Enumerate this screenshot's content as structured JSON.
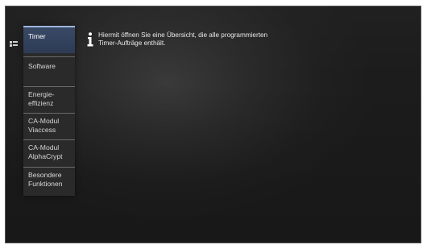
{
  "menu": {
    "toggle_icon": "menu-grid-icon",
    "items": [
      {
        "line1": "Timer",
        "line2": "",
        "active": true
      },
      {
        "line1": "Software",
        "line2": "",
        "active": false
      },
      {
        "line1": "Energie-",
        "line2": "effizienz",
        "active": false
      },
      {
        "line1": "CA-Modul",
        "line2": "Viaccess",
        "active": false
      },
      {
        "line1": "CA-Modul",
        "line2": "AlphaCrypt",
        "active": false
      },
      {
        "line1": "Besondere",
        "line2": "Funktionen",
        "active": false
      }
    ]
  },
  "info": {
    "icon": "info-icon",
    "line1": "Hiermit öffnen Sie eine Übersicht, die alle programmierten",
    "line2": "Timer-Aufträge enthält."
  },
  "colors": {
    "background": "#1f1f1f",
    "menu_background": "#2a2a2a",
    "active_item": "#34445f",
    "text": "#d7d7d7"
  }
}
